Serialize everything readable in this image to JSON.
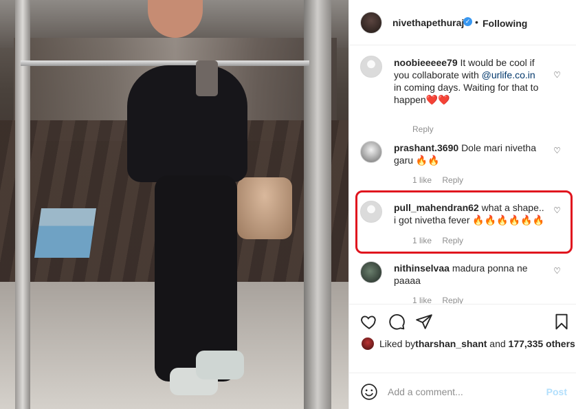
{
  "post": {
    "username": "nivethapethuraj",
    "verified_mark": "✓",
    "separator": "•",
    "follow_status": "Following"
  },
  "comments": [
    {
      "handle": "noobieeeee79",
      "text_before": "It would be cool if you collaborate with ",
      "mention": "@urlife.co.in",
      "text_after": " in coming days. Waiting for that to happen❤️❤️",
      "likes": "",
      "reply": "Reply",
      "avatar": "default-avatar"
    },
    {
      "handle": "prashant.3690",
      "text": "Dole mari nivetha garu 🔥🔥",
      "likes": "1 like",
      "reply": "Reply",
      "avatar": "user-photo"
    },
    {
      "handle": "pull_mahendran62",
      "text": "what a shape.. i got nivetha fever 🔥🔥🔥🔥🔥🔥",
      "likes": "1 like",
      "reply": "Reply",
      "avatar": "default-avatar",
      "highlighted": true,
      "highlight_color": "#e0141e"
    },
    {
      "handle": "nithinselvaa",
      "text": "madura ponna ne paaaa",
      "likes": "1 like",
      "reply": "Reply",
      "avatar": "user-photo"
    }
  ],
  "actions": {
    "like_icon": "heart-outline-icon",
    "comment_icon": "speech-bubble-icon",
    "share_icon": "paper-plane-icon",
    "save_icon": "bookmark-icon"
  },
  "likes": {
    "prefix": "Liked by ",
    "user": "tharshan_shant",
    "connector": " and ",
    "count_text": "177,335 others"
  },
  "add_comment": {
    "placeholder": "Add a comment...",
    "post_label": "Post",
    "emoji_icon": "smiley-icon"
  },
  "colors": {
    "verified": "#3897f0",
    "mention": "#00376b",
    "post_button": "#b2dffc",
    "highlight": "#e0141e"
  }
}
